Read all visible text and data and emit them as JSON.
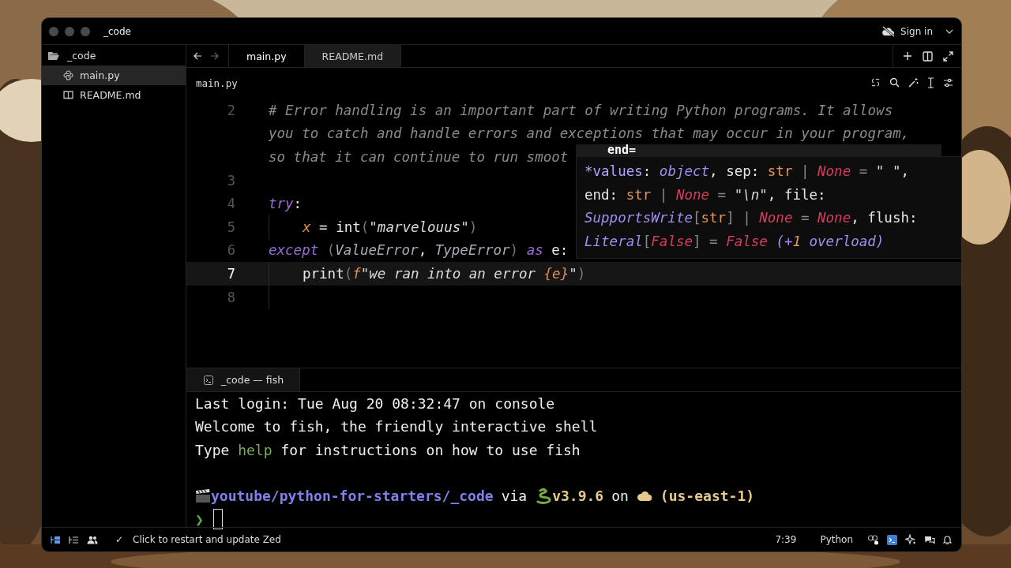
{
  "window": {
    "title": "_code",
    "sign_in": "Sign in"
  },
  "sidebar": {
    "root": {
      "label": "_code",
      "expanded": true,
      "children": [
        {
          "label": "main.py",
          "selected": true,
          "kind": "python"
        },
        {
          "label": "README.md",
          "selected": false,
          "kind": "markdown"
        }
      ]
    }
  },
  "tabs": [
    {
      "label": "main.py",
      "selected": true
    },
    {
      "label": "README.md",
      "selected": false
    }
  ],
  "breadcrumb": "main.py",
  "editor": {
    "rows": [
      {
        "number": "2",
        "current": false,
        "indented": false,
        "tokens": [
          {
            "kind": "comment",
            "text": "# Error handling is an important part of writing Python programs. It allows"
          }
        ]
      },
      {
        "current": false,
        "indented": false,
        "tokens": [
          {
            "kind": "comment",
            "text": "you to catch and handle errors and exceptions that may occur in your program,"
          }
        ]
      },
      {
        "current": false,
        "indented": false,
        "tokens": [
          {
            "kind": "comment",
            "text": "so that it can continue to run smoot"
          }
        ]
      },
      {
        "number": "3",
        "current": false,
        "indented": false
      },
      {
        "number": "4",
        "current": false,
        "indented": false,
        "tokens": [
          {
            "kind": "keyword",
            "text": "try"
          },
          {
            "kind": "plain",
            "text": ":"
          }
        ]
      },
      {
        "number": "5",
        "current": false,
        "indented": true,
        "tokens": [
          {
            "kind": "variable",
            "text": "x"
          },
          {
            "kind": "plain",
            "text": " = int"
          },
          {
            "kind": "punct",
            "text": "("
          },
          {
            "kind": "string",
            "text": "\"marvelouus\""
          },
          {
            "kind": "punct",
            "text": ")"
          }
        ]
      },
      {
        "number": "6",
        "current": false,
        "indented": false,
        "tokens": [
          {
            "kind": "keyword",
            "text": "except"
          },
          {
            "kind": "punct",
            "text": " ("
          },
          {
            "kind": "class",
            "text": "ValueError"
          },
          {
            "kind": "plain",
            "text": ", "
          },
          {
            "kind": "class",
            "text": "TypeError"
          },
          {
            "kind": "punct",
            "text": ") "
          },
          {
            "kind": "keyword",
            "text": "as"
          },
          {
            "kind": "plain",
            "text": " e:"
          }
        ]
      },
      {
        "number": "7",
        "current": true,
        "indented": true,
        "tokens": [
          {
            "kind": "plain",
            "text": "print"
          },
          {
            "kind": "punct",
            "text": "("
          },
          {
            "kind": "variable",
            "text": "f"
          },
          {
            "kind": "string",
            "text": "\"we ran into an error "
          },
          {
            "kind": "variable",
            "text": "{e}"
          },
          {
            "kind": "string",
            "text": "\""
          },
          {
            "kind": "punct",
            "text": ")"
          }
        ]
      },
      {
        "number": "8",
        "current": false,
        "indented": true
      }
    ]
  },
  "hover_popup": {
    "header": "end=",
    "lines": [
      [
        {
          "kind": "param",
          "text": "*values"
        },
        {
          "kind": "plain",
          "text": ": "
        },
        {
          "kind": "type",
          "text": "object"
        },
        {
          "kind": "plain",
          "text": ", sep: "
        },
        {
          "kind": "builtin",
          "text": "str"
        },
        {
          "kind": "op",
          "text": " | "
        },
        {
          "kind": "const",
          "text": "None"
        },
        {
          "kind": "op",
          "text": " = "
        },
        {
          "kind": "string",
          "text": "\" \""
        },
        {
          "kind": "plain",
          "text": ","
        }
      ],
      [
        {
          "kind": "plain",
          "text": "end: "
        },
        {
          "kind": "builtin",
          "text": "str"
        },
        {
          "kind": "op",
          "text": " | "
        },
        {
          "kind": "const",
          "text": "None"
        },
        {
          "kind": "op",
          "text": " = "
        },
        {
          "kind": "string",
          "text": "\"\\n\""
        },
        {
          "kind": "plain",
          "text": ", file:"
        }
      ],
      [
        {
          "kind": "type",
          "text": "SupportsWrite"
        },
        {
          "kind": "op",
          "text": "["
        },
        {
          "kind": "builtin",
          "text": "str"
        },
        {
          "kind": "op",
          "text": "] | "
        },
        {
          "kind": "const",
          "text": "None"
        },
        {
          "kind": "op",
          "text": " = "
        },
        {
          "kind": "const",
          "text": "None"
        },
        {
          "kind": "plain",
          "text": ", flush:"
        }
      ],
      [
        {
          "kind": "type",
          "text": "Literal"
        },
        {
          "kind": "op",
          "text": "["
        },
        {
          "kind": "const",
          "text": "False"
        },
        {
          "kind": "op",
          "text": "] = "
        },
        {
          "kind": "const",
          "text": "False"
        },
        {
          "kind": "type",
          "text": " (+"
        },
        {
          "kind": "number",
          "text": "1"
        },
        {
          "kind": "type",
          "text": " overload)"
        }
      ]
    ]
  },
  "terminal": {
    "tab": "_code — fish",
    "lines": [
      [
        {
          "kind": "plain",
          "text": "Last login: Tue Aug 20 08:32:47 on console"
        }
      ],
      [
        {
          "kind": "plain",
          "text": "Welcome to fish, the friendly interactive shell"
        }
      ],
      [
        {
          "kind": "plain",
          "text": "Type "
        },
        {
          "kind": "command",
          "text": "help"
        },
        {
          "kind": "plain",
          "text": " for instructions on how to use fish"
        }
      ]
    ],
    "prompt": {
      "path": "youtube/python-for-starters/_code",
      "via": "via",
      "version": "v3.9.6",
      "on": "on",
      "region": "(us-east-1)",
      "symbol": "❯"
    }
  },
  "status_bar": {
    "check": "✓",
    "message": "Click to restart and update Zed",
    "position": "7:39",
    "language": "Python"
  }
}
